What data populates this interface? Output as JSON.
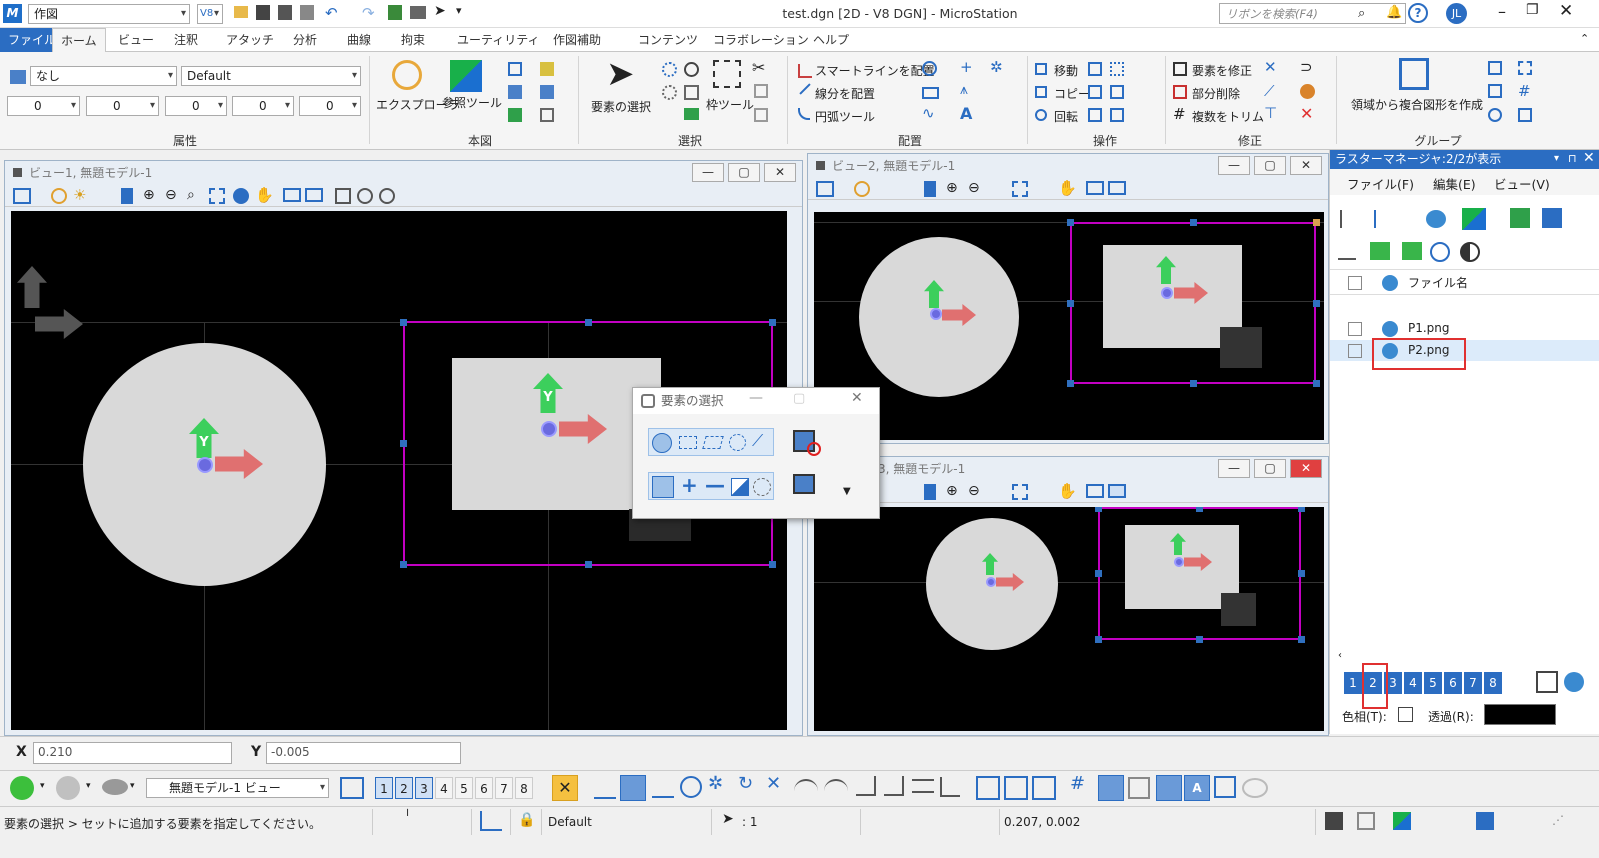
{
  "app": {
    "quick_combo": "作図",
    "v8_label": "V8",
    "title": "test.dgn [2D - V8 DGN] - MicroStation",
    "search_placeholder": "リボンを検索(F4)",
    "user_initials": "JL",
    "logo_letter": "M"
  },
  "tabs": [
    {
      "label": "ファイル"
    },
    {
      "label": "ホーム"
    },
    {
      "label": "ビュー"
    },
    {
      "label": "注釈"
    },
    {
      "label": "アタッチ"
    },
    {
      "label": "分析"
    },
    {
      "label": "曲線"
    },
    {
      "label": "拘束"
    },
    {
      "label": "ユーティリティ"
    },
    {
      "label": "作図補助"
    },
    {
      "label": "コンテンツ"
    },
    {
      "label": "コラボレーション"
    },
    {
      "label": "ヘルプ"
    }
  ],
  "ribbon": {
    "attributes": {
      "level": "なし",
      "style": "Default",
      "color": "0",
      "weight": "0",
      "linestyle": "0",
      "transparency": "0",
      "priority": "0",
      "group_label": "属性"
    },
    "model": {
      "explorer": "エクスプローラ",
      "reference": "参照ツール",
      "group_label": "本図"
    },
    "select": {
      "element_select": "要素の選択",
      "fence_tool": "枠ツール",
      "group_label": "選択"
    },
    "place": {
      "smartline": "スマートラインを配置",
      "line": "線分を配置",
      "arc": "円弧ツール",
      "group_label": "配置"
    },
    "manipulate": {
      "move": "移動",
      "copy": "コピー",
      "rotate": "回転",
      "group_label": "操作"
    },
    "modify": {
      "modify": "要素を修正",
      "partial_delete": "部分削除",
      "trim_multiple": "複数をトリム",
      "group_label": "修正"
    },
    "groups": {
      "create_region": "領域から複合図形を作成",
      "group_label": "グループ"
    }
  },
  "views": [
    {
      "title": "ビュー1, 無題モデル-1"
    },
    {
      "title": "ビュー2, 無題モデル-1"
    },
    {
      "title": "3, 無題モデル-1"
    }
  ],
  "popup": {
    "title": "要素の選択"
  },
  "raster": {
    "title": "ラスターマネージャ:2/2が表示",
    "menu": [
      "ファイル(F)",
      "編集(E)",
      "ビュー(V)"
    ],
    "column_header": "ファイル名",
    "files": [
      "P1.png",
      "P2.png"
    ],
    "view_numbers": [
      "1",
      "2",
      "3",
      "4",
      "5",
      "6",
      "7",
      "8"
    ],
    "color_label": "色相(T):",
    "transparency_label": "透過(R):"
  },
  "coords": {
    "x_label": "X",
    "x_value": "0.210",
    "y_label": "Y",
    "y_value": "-0.005"
  },
  "viewbar": {
    "model_view": "無題モデル-1 ビュー",
    "view_numbers": [
      "1",
      "2",
      "3",
      "4",
      "5",
      "6",
      "7",
      "8"
    ]
  },
  "status": {
    "prompt": "要素の選択 > セットに追加する要素を指定してください。",
    "level": "Default",
    "selection_count": ": 1",
    "position": "0.207, 0.002"
  },
  "axis": {
    "y": "Y"
  },
  "colors": {
    "accent": "#2b6dc2",
    "selection": "#c300c3",
    "handle": "#2f6fbf",
    "y_axis": "#3ccf5c",
    "x_axis": "#e07070",
    "highlight": "#e03030"
  }
}
